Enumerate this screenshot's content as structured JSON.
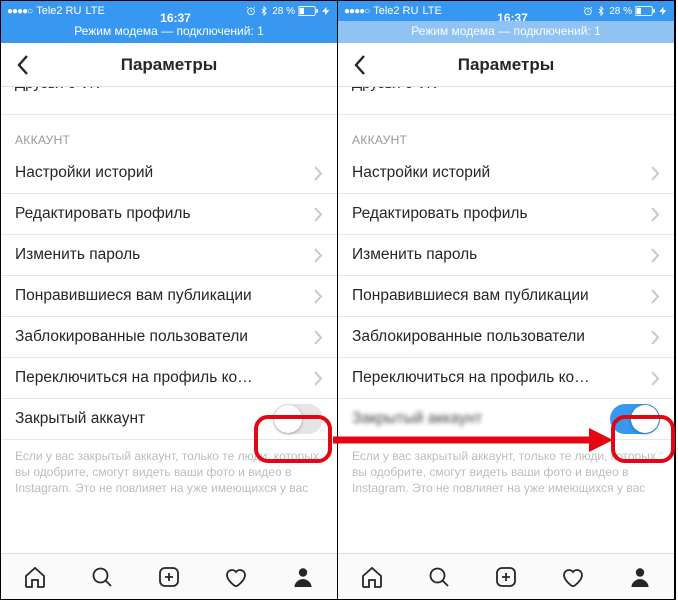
{
  "status": {
    "carrier": "Tele2 RU",
    "network": "LTE",
    "time": "16:37",
    "battery_pct": "28 %"
  },
  "hotspot_text": "Режим модема — подключений: 1",
  "nav_title": "Параметры",
  "truncated_top": "Друзья с VK",
  "section_account": "АККАУНТ",
  "rows": {
    "stories": "Настройки историй",
    "edit_profile": "Редактировать профиль",
    "change_password": "Изменить пароль",
    "liked_posts": "Понравившиеся вам публикации",
    "blocked": "Заблокированные пользователи",
    "switch_profile": "Переключиться на профиль ко…",
    "private_account": "Закрытый аккаунт"
  },
  "footer_note": "Если у вас закрытый аккаунт, только те люди, которых вы одобрите, смогут видеть ваши фото и видео в Instagram. Это не повлияет на уже имеющихся у вас"
}
